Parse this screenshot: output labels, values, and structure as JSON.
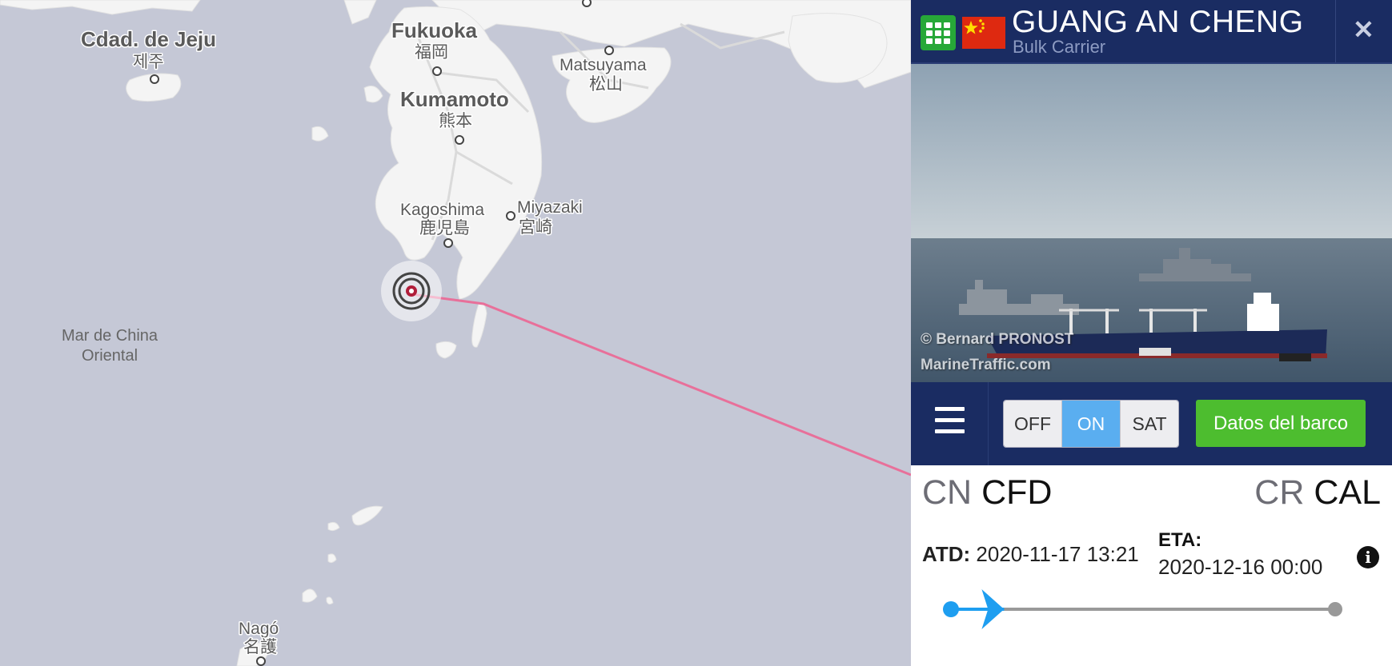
{
  "map": {
    "cities": [
      {
        "name": "Cdad. de Jeju",
        "native": "제주"
      },
      {
        "name": "Fukuoka",
        "native": "福岡"
      },
      {
        "name": "Kumamoto",
        "native": "熊本"
      },
      {
        "name": "Matsuyama",
        "native": "松山"
      },
      {
        "name": "Kagoshima",
        "native": "鹿児島"
      },
      {
        "name": "Miyazaki",
        "native": "宮崎"
      },
      {
        "name": "Nagó",
        "native": "名護"
      }
    ],
    "sea": {
      "line1": "Mar de China",
      "line2": "Oriental"
    },
    "route_color": "#e8709a",
    "vessel_marker_color": "#b01d3a"
  },
  "vessel": {
    "name": "GUANG AN CHENG",
    "type": "Bulk Carrier",
    "flag": "china-flag",
    "photo_credit": "© Bernard PRONOST",
    "photo_source": "MarineTraffic.com"
  },
  "header": {
    "grid_icon": "grid-icon",
    "close_icon": "close-icon"
  },
  "toolbar": {
    "menu_icon": "hamburger-menu-icon",
    "toggle": [
      "OFF",
      "ON",
      "SAT"
    ],
    "toggle_selected": "ON",
    "details_label": "Datos del barco",
    "details_color": "#4dbd2f"
  },
  "voyage": {
    "departure": {
      "country": "CN",
      "port": "CFD"
    },
    "destination": {
      "country": "CR",
      "port": "CAL"
    },
    "atd_label": "ATD:",
    "atd_value": "2020-11-17 13:21",
    "eta_label": "ETA:",
    "eta_value": "2020-12-16 00:00",
    "progress_fraction": 0.08,
    "progress_color": "#1e9ef0"
  }
}
